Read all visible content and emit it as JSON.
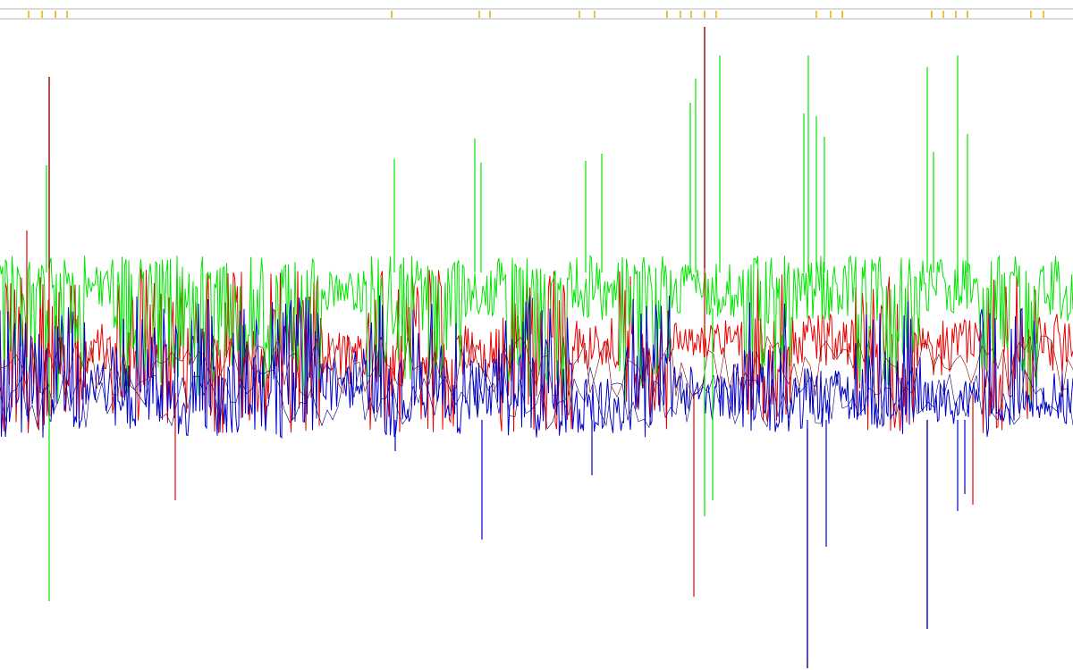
{
  "colors": {
    "background": "#ffffff",
    "track_line": "#b4b4b4",
    "tick": "#e0b000",
    "red": "#e60000",
    "green": "#00e600",
    "blue": "#0000cc",
    "dark_red": "#800000",
    "dark_green": "#008000",
    "dark_blue": "#000080"
  },
  "chart_data": {
    "type": "line",
    "title": "",
    "xlabel": "",
    "ylabel": "",
    "grid": false,
    "legend": "none",
    "marker_ticks": [
      32,
      47,
      62,
      75,
      438,
      536,
      548,
      648,
      665,
      746,
      761,
      773,
      788,
      801,
      913,
      929,
      942,
      1042,
      1055,
      1069,
      1082,
      1153,
      1167
    ],
    "series": [
      {
        "color_key": "green",
        "base": 305,
        "noise": [
          40,
          18
        ],
        "drop": [
          40,
          130
        ],
        "drop_prob": 0.5,
        "spikes": [
          [
            52,
            185
          ],
          [
            441,
            178
          ],
          [
            531,
            155
          ],
          [
            538,
            182
          ],
          [
            655,
            180
          ],
          [
            673,
            172
          ],
          [
            772,
            115
          ],
          [
            778,
            88
          ],
          [
            805,
            62
          ],
          [
            899,
            127
          ],
          [
            904,
            62
          ],
          [
            913,
            130
          ],
          [
            922,
            153
          ],
          [
            1037,
            75
          ],
          [
            1044,
            170
          ],
          [
            1071,
            62
          ],
          [
            1082,
            150
          ],
          [
            55,
            673
          ],
          [
            788,
            578
          ],
          [
            797,
            560
          ]
        ]
      },
      {
        "color_key": "red",
        "base": 400,
        "noise": [
          70,
          60
        ],
        "drop": [
          0,
          0
        ],
        "drop_prob": 0,
        "spikes": [
          [
            55,
            86
          ],
          [
            788,
            30
          ],
          [
            30,
            258
          ],
          [
            196,
            560
          ],
          [
            776,
            668
          ],
          [
            1088,
            565
          ]
        ]
      },
      {
        "color_key": "blue",
        "base": 430,
        "noise": [
          90,
          45
        ],
        "drop": [
          0,
          0
        ],
        "drop_prob": 0,
        "spikes": [
          [
            539,
            604
          ],
          [
            903,
            748
          ],
          [
            924,
            612
          ],
          [
            1037,
            704
          ],
          [
            1079,
            553
          ],
          [
            1071,
            572
          ],
          [
            442,
            505
          ],
          [
            662,
            532
          ]
        ]
      }
    ],
    "dense_regions": [
      {
        "x": [
          640,
          690
        ],
        "green": [
          285,
          360
        ],
        "red": [
          355,
          420
        ],
        "blue": [
          420,
          485
        ]
      },
      {
        "x": [
          750,
          830
        ],
        "green": [
          290,
          355
        ],
        "red": [
          358,
          400
        ],
        "blue": [
          405,
          470
        ]
      },
      {
        "x": [
          885,
          955
        ],
        "green": [
          285,
          360
        ],
        "red": [
          350,
          410
        ],
        "blue": [
          410,
          480
        ]
      },
      {
        "x": [
          1030,
          1095
        ],
        "green": [
          290,
          355
        ],
        "red": [
          355,
          420
        ],
        "blue": [
          425,
          475
        ]
      },
      {
        "x": [
          1160,
          1200
        ],
        "green": [
          285,
          360
        ],
        "red": [
          350,
          420
        ],
        "blue": [
          415,
          475
        ]
      },
      {
        "x": [
          95,
          125
        ],
        "green": [
          295,
          345
        ],
        "red": [
          360,
          420
        ],
        "blue": [
          405,
          460
        ]
      },
      {
        "x": [
          360,
          410
        ],
        "green": [
          300,
          350
        ],
        "red": [
          370,
          430
        ],
        "blue": [
          390,
          460
        ]
      },
      {
        "x": [
          520,
          555
        ],
        "green": [
          300,
          355
        ],
        "red": [
          360,
          425
        ],
        "blue": [
          400,
          470
        ]
      }
    ]
  }
}
